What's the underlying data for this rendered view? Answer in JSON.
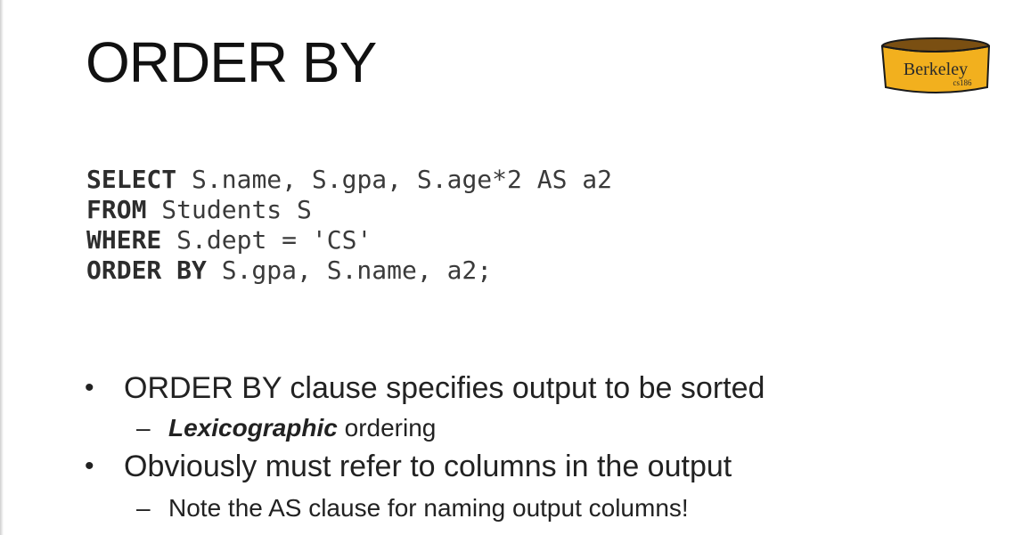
{
  "slide": {
    "title": "ORDER BY",
    "logo": {
      "text": "Berkeley",
      "subtext": "cs186",
      "color": "#f2b01e"
    }
  },
  "code": [
    {
      "keyword": "SELECT",
      "rest": " S.name, S.gpa, S.age*2 AS a2"
    },
    {
      "keyword": "FROM",
      "rest": " Students S"
    },
    {
      "keyword": "WHERE",
      "rest": " S.dept = 'CS'"
    },
    {
      "keyword": "ORDER BY",
      "rest": " S.gpa, S.name, a2;"
    }
  ],
  "bullets": [
    {
      "text": "ORDER BY clause specifies output to be sorted",
      "sub": {
        "emphasis": "Lexicographic",
        "rest": " ordering"
      }
    },
    {
      "text": "Obviously must refer to columns in the output",
      "sub": {
        "emphasis": "",
        "rest": "Note the AS clause for naming output columns!"
      }
    }
  ],
  "symbols": {
    "bullet": "•",
    "dash": "–"
  }
}
